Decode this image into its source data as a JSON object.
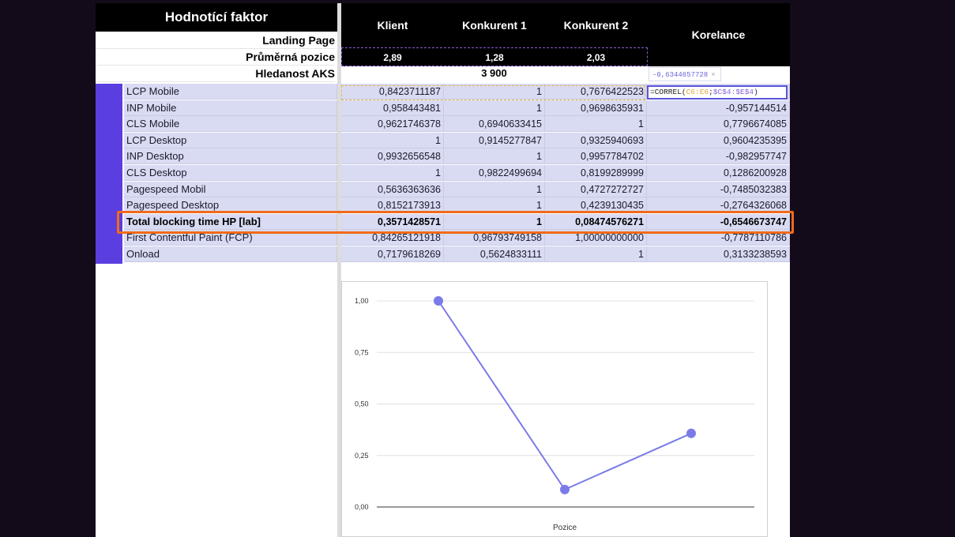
{
  "header": {
    "factor": "Hodnotící faktor",
    "columns": [
      "Klient",
      "Konkurent 1",
      "Konkurent 2",
      "Korelance"
    ]
  },
  "top_rows": {
    "landing_page": "Landing Page",
    "avg_position_label": "Průměrná pozice",
    "avg_positions": [
      "2,89",
      "1,28",
      "2,03"
    ],
    "search_volume_label": "Hledanost AKS",
    "search_volume": "3 900"
  },
  "tooltip": {
    "value": "-0,6344657728",
    "close": "×"
  },
  "formula": {
    "prefix": "=CORREL(",
    "range1": "C6:E6",
    "sep": ";",
    "range2": "$C$4:$E$4",
    "suffix": ")"
  },
  "rows": [
    {
      "name": "LCP Mobile",
      "klient": "0,8423711187",
      "k1": "1",
      "k2": "0,7676422523",
      "korelance": ""
    },
    {
      "name": "INP Mobile",
      "klient": "0,958443481",
      "k1": "1",
      "k2": "0,9698635931",
      "korelance": "-0,957144514"
    },
    {
      "name": "CLS Mobile",
      "klient": "0,9621746378",
      "k1": "0,6940633415",
      "k2": "1",
      "korelance": "0,7796674085"
    },
    {
      "name": "LCP Desktop",
      "klient": "1",
      "k1": "0,9145277847",
      "k2": "0,9325940693",
      "korelance": "0,9604235395"
    },
    {
      "name": "INP Desktop",
      "klient": "0,9932656548",
      "k1": "1",
      "k2": "0,9957784702",
      "korelance": "-0,982957747"
    },
    {
      "name": "CLS Desktop",
      "klient": "1",
      "k1": "0,9822499694",
      "k2": "0,8199289999",
      "korelance": "0,1286200928"
    },
    {
      "name": "Pagespeed Mobil",
      "klient": "0,5636363636",
      "k1": "1",
      "k2": "0,4727272727",
      "korelance": "-0,7485032383"
    },
    {
      "name": "Pagespeed Desktop",
      "klient": "0,8152173913",
      "k1": "1",
      "k2": "0,4239130435",
      "korelance": "-0,2764326068"
    },
    {
      "name": "Total blocking time HP [lab]",
      "klient": "0,3571428571",
      "k1": "1",
      "k2": "0,08474576271",
      "korelance": "-0,6546673747"
    },
    {
      "name": "First Contentful Paint (FCP)",
      "klient": "0,84265121918",
      "k1": "0,96793749158",
      "k2": "1,00000000000",
      "korelance": "-0,7787110786"
    },
    {
      "name": "Onload",
      "klient": "0,7179618269",
      "k1": "0,5624833111",
      "k2": "1",
      "korelance": "0,3133238593"
    }
  ],
  "colors": {
    "accent": "#5b3ee0",
    "row_bg": "#d9dbf3",
    "highlight": "#ef6b1a",
    "line": "#7b7be8"
  },
  "chart_data": {
    "type": "line",
    "x": [
      1,
      2,
      3
    ],
    "series": [
      {
        "values": [
          1.0,
          0.08474576271,
          0.3571428571
        ]
      }
    ],
    "yticks": [
      "1,00",
      "0,75",
      "0,50",
      "0,25",
      "0,00"
    ],
    "ylim": [
      0,
      1
    ],
    "xlabel": "Pozice",
    "grid": true
  }
}
